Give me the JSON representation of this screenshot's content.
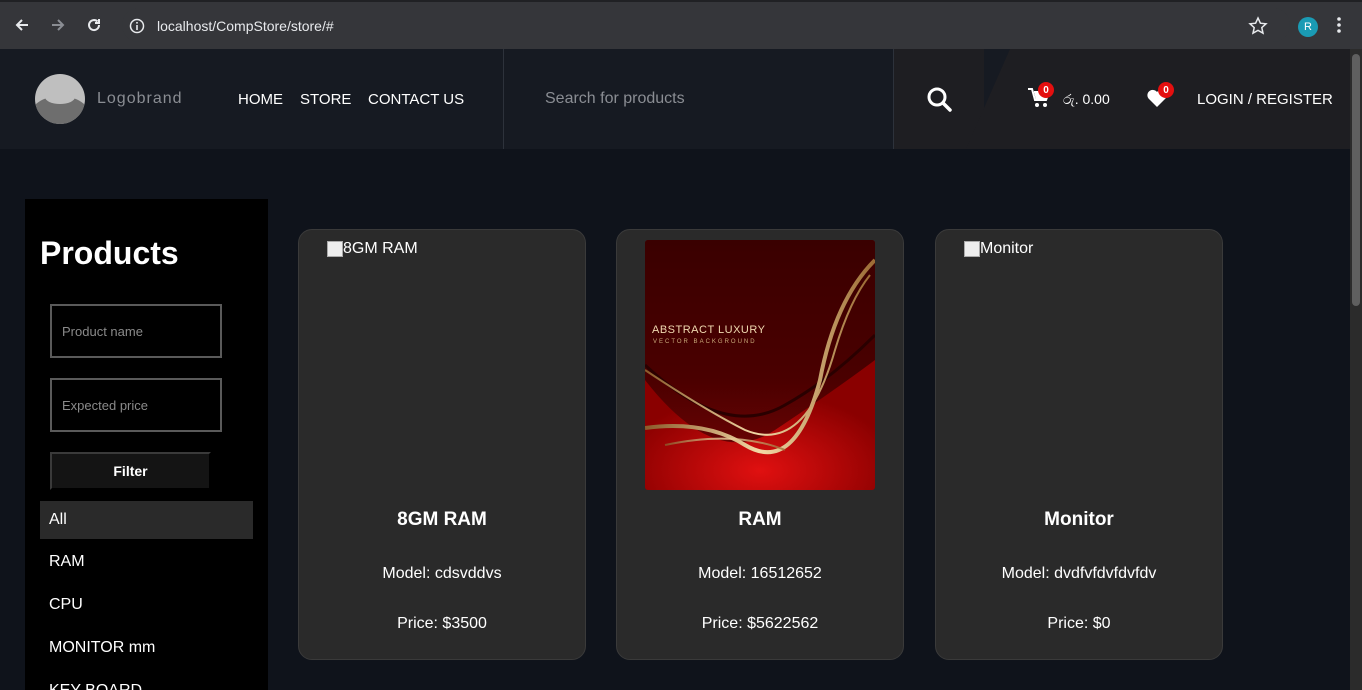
{
  "browser": {
    "url": "localhost/CompStore/store/#",
    "profile_initial": "R"
  },
  "header": {
    "brand": "Logobrand",
    "nav": [
      "HOME",
      "STORE",
      "CONTACT US"
    ],
    "search_placeholder": "Search for products",
    "cart_count": "0",
    "money": "රු. 0.00",
    "wishlist_count": "0",
    "login": "LOGIN / REGISTER"
  },
  "sidebar": {
    "title": "Products",
    "name_placeholder": "Product name",
    "price_placeholder": "Expected price",
    "filter_label": "Filter",
    "categories": [
      "All",
      "RAM",
      "CPU",
      "MONITOR mm",
      "KEY BOARD"
    ]
  },
  "products": [
    {
      "alt": "8GM RAM",
      "title": "8GM RAM",
      "model": "Model: cdsvddvs",
      "price": "Price: $3500"
    },
    {
      "alt": "RAM",
      "title": "RAM",
      "model": "Model: 16512652",
      "price": "Price: $5622562",
      "image_text": "ABSTRACT LUXURY",
      "image_subtext": "VECTOR BACKGROUND"
    },
    {
      "alt": "Monitor",
      "title": "Monitor",
      "model": "Model: dvdfvfdvfdvfdv",
      "price": "Price: $0"
    }
  ]
}
